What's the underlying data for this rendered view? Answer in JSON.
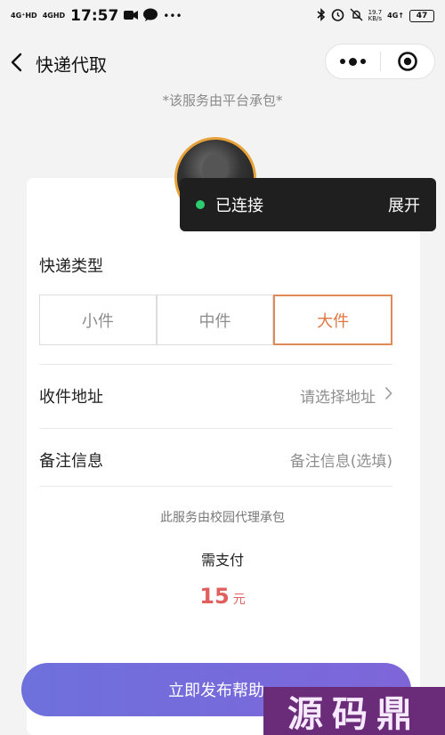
{
  "status_bar": {
    "network1": "4G⁺HD",
    "network2": "4GHD",
    "time": "17:57",
    "speed_value": "19.7",
    "speed_unit": "KB/s",
    "network3": "4G↑",
    "battery": "47"
  },
  "navbar": {
    "title": "快递代取"
  },
  "platform_note": "*该服务由平台承包*",
  "toast": {
    "status": "已连接",
    "action": "展开",
    "dot_color": "#2ecc71"
  },
  "form": {
    "type_label": "快递类型",
    "types": [
      {
        "label": "小件",
        "active": false
      },
      {
        "label": "中件",
        "active": false
      },
      {
        "label": "大件",
        "active": true
      }
    ],
    "address_label": "收件地址",
    "address_placeholder": "请选择地址",
    "note_label": "备注信息",
    "note_placeholder": "备注信息(选填)"
  },
  "agency_note": "此服务由校园代理承包",
  "payment": {
    "label": "需支付",
    "amount": "15",
    "unit": "元"
  },
  "submit_label": "立即发布帮助",
  "watermark": "源码鼎",
  "colors": {
    "accent": "#e07740",
    "price": "#e06060",
    "button_start": "#6e70dc",
    "button_end": "#7e66d9"
  }
}
